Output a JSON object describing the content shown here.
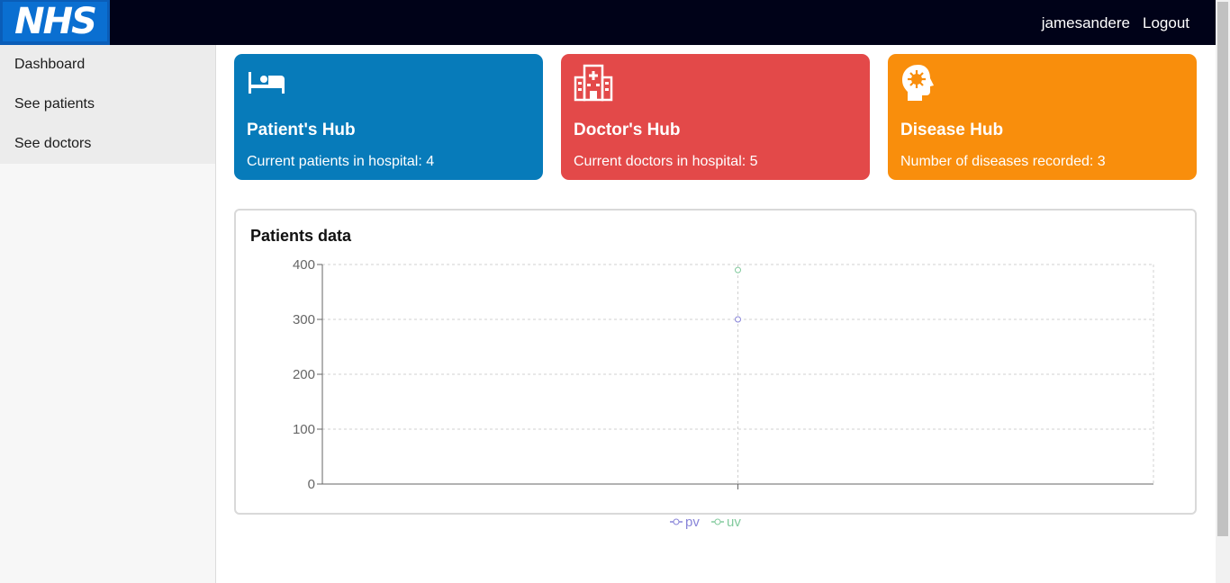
{
  "header": {
    "logo_text": "NHS",
    "username": "jamesandere",
    "logout_label": "Logout"
  },
  "sidebar": {
    "items": [
      {
        "label": "Dashboard"
      },
      {
        "label": "See patients"
      },
      {
        "label": "See doctors"
      }
    ]
  },
  "cards": [
    {
      "title": "Patient's Hub",
      "description": "Current patients in hospital: 4",
      "color": "#077bba",
      "icon": "bed-icon"
    },
    {
      "title": "Doctor's Hub",
      "description": "Current doctors in hospital: 5",
      "color": "#e34949",
      "icon": "hospital-building-icon"
    },
    {
      "title": "Disease Hub",
      "description": "Number of diseases recorded: 3",
      "color": "#f98e0c",
      "icon": "brain-virus-icon"
    }
  ],
  "panel": {
    "title": "Patients data"
  },
  "chart_data": {
    "type": "line",
    "x": [
      ""
    ],
    "series": [
      {
        "name": "pv",
        "values": [
          300
        ],
        "color": "#8884d8"
      },
      {
        "name": "uv",
        "values": [
          390
        ],
        "color": "#82ca9d"
      }
    ],
    "yticks": [
      0,
      100,
      200,
      300,
      400
    ],
    "ylim": [
      0,
      400
    ],
    "grid": true,
    "legend": "bottom-center"
  }
}
